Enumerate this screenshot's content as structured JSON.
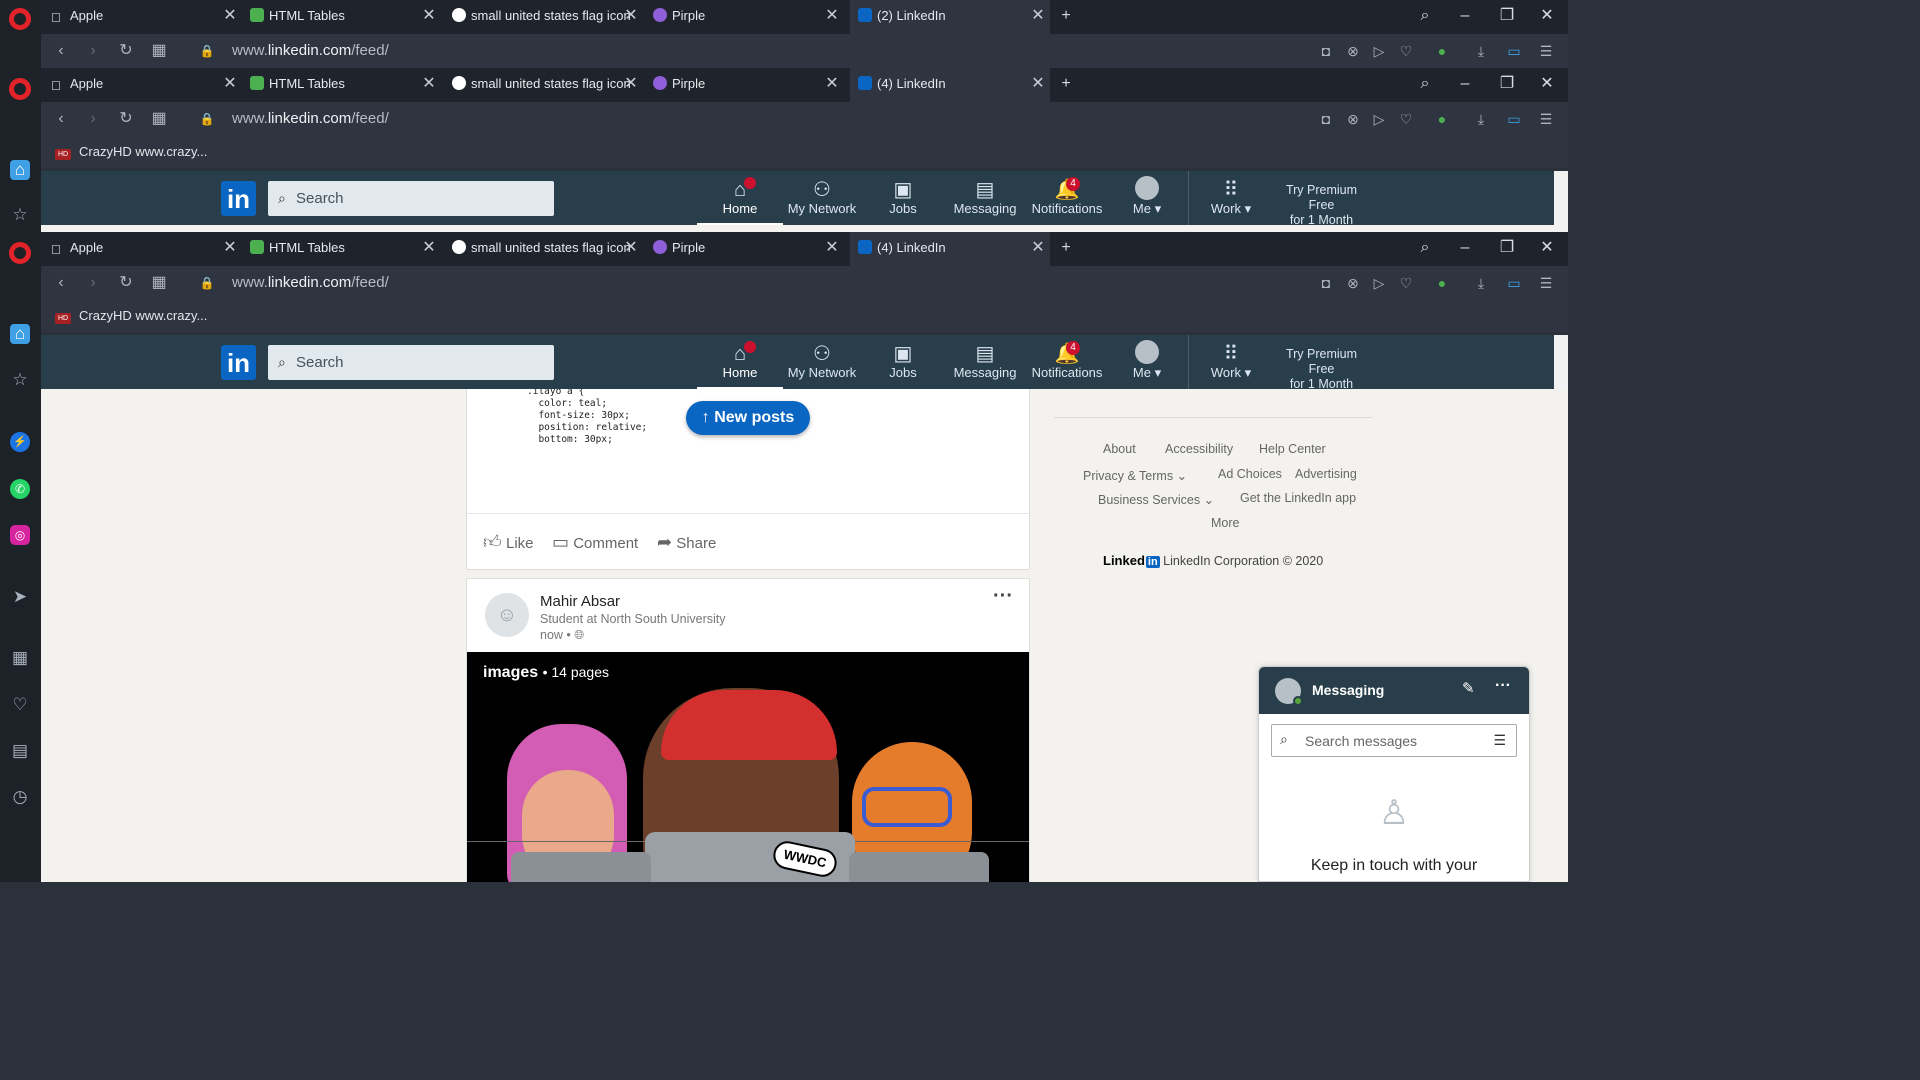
{
  "browser": {
    "tabs": [
      {
        "label": "Apple",
        "icon": "apple-icon"
      },
      {
        "label": "HTML Tables",
        "icon": "w3schools-icon"
      },
      {
        "label": "small united states flag icon",
        "icon": "google-icon"
      },
      {
        "label": "Pirple",
        "icon": "pirple-icon"
      },
      {
        "label": "(2) LinkedIn",
        "icon": "linkedin-icon"
      }
    ],
    "tabs_second": [
      {
        "label": "Apple"
      },
      {
        "label": "HTML Tables"
      },
      {
        "label": "small united states flag icon"
      },
      {
        "label": "Pirple"
      },
      {
        "label": "(4) LinkedIn"
      }
    ],
    "url_host": "www.",
    "url_domain": "linkedin.com",
    "url_path": "/feed/",
    "bookmark": "CrazyHD www.crazy..."
  },
  "linkedin": {
    "search_placeholder": "Search",
    "nav": [
      {
        "label": "Home",
        "icon": "home-icon"
      },
      {
        "label": "My Network",
        "icon": "network-icon"
      },
      {
        "label": "Jobs",
        "icon": "briefcase-icon"
      },
      {
        "label": "Messaging",
        "icon": "chat-icon"
      },
      {
        "label": "Notifications",
        "icon": "bell-icon",
        "badge": "4"
      },
      {
        "label": "Me",
        "icon": "avatar-icon"
      },
      {
        "label": "Work",
        "icon": "grid-icon"
      }
    ],
    "premium": "Try Premium Free for 1 Month",
    "premium_line1": "Try Premium Free",
    "premium_line2": "for 1 Month"
  },
  "feed": {
    "code_snippet": ".ilayo a {\n  color: teal;\n  font-size: 30px;\n  position: relative;\n  bottom: 30px;",
    "new_posts": "New posts",
    "actions": {
      "like": "Like",
      "comment": "Comment",
      "share": "Share"
    },
    "post": {
      "author": "Mahir Absar",
      "headline": "Student at North South University",
      "time": "now •",
      "doc_title": "images",
      "doc_pages": "• 14 pages",
      "sticker": "WWDC"
    }
  },
  "footer": {
    "links": [
      "About",
      "Accessibility",
      "Help Center",
      "Privacy & Terms",
      "Ad Choices",
      "Advertising",
      "Business Services",
      "Get the LinkedIn app",
      "More"
    ],
    "brand": "Linked",
    "brand_in": "in",
    "copyright": "LinkedIn Corporation © 2020"
  },
  "messaging": {
    "title": "Messaging",
    "search_placeholder": "Search messages",
    "empty_text": "Keep in touch with your"
  },
  "colors": {
    "linkedin_blue": "#0a66c2",
    "nav_bg": "#283e4a",
    "badge_red": "#cb112d",
    "opera_red": "#e2232a"
  }
}
